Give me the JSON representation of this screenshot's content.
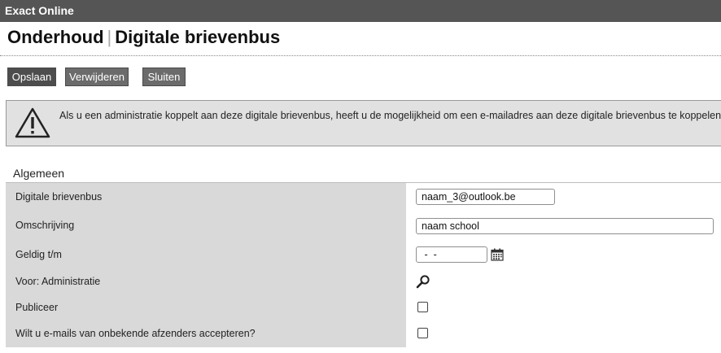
{
  "app": {
    "title": "Exact Online"
  },
  "header": {
    "section": "Onderhoud",
    "separator": "|",
    "title": "Digitale brievenbus"
  },
  "toolbar": {
    "save_label": "Opslaan",
    "delete_label": "Verwijderen",
    "close_label": "Sluiten"
  },
  "alert": {
    "icon": "warning-icon",
    "message": "Als u een administratie koppelt aan deze digitale brievenbus, heeft u de mogelijkheid om een e-mailadres aan deze digitale brievenbus te koppelen."
  },
  "form": {
    "section_title": "Algemeen",
    "fields": {
      "mailbox": {
        "label": "Digitale brievenbus",
        "value": "naam_3@outlook.be"
      },
      "description": {
        "label": "Omschrijving",
        "value": "naam school"
      },
      "valid_until": {
        "label": "Geldig t/m",
        "value": " -  -",
        "icon": "calendar-icon"
      },
      "administration": {
        "label": "Voor: Administratie",
        "icon": "search-icon"
      },
      "publish": {
        "label": "Publiceer",
        "checked": false
      },
      "accept_unknown": {
        "label": "Wilt u e-mails van onbekende afzenders accepteren?",
        "checked": false
      }
    }
  }
}
